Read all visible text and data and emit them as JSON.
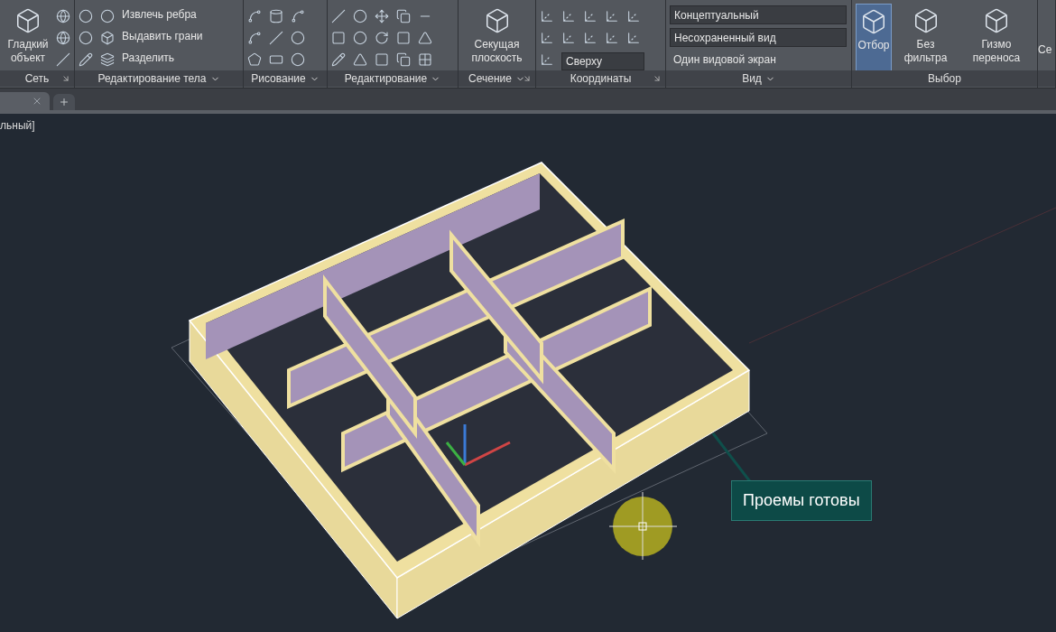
{
  "ribbon": {
    "panels": [
      {
        "title": "Сеть",
        "menu": false,
        "launcher": true,
        "tools": [
          {
            "kind": "large",
            "label": "Гладкий объект",
            "selected": false
          }
        ]
      },
      {
        "title": "Редактирование тела",
        "menu": true,
        "launcher": false,
        "tools": [
          {
            "kind": "row",
            "label": "Извлечь ребра"
          },
          {
            "kind": "row",
            "label": "Выдавить грани"
          },
          {
            "kind": "row",
            "label": "Разделить"
          }
        ]
      },
      {
        "title": "Рисование",
        "menu": true,
        "launcher": false
      },
      {
        "title": "Редактирование",
        "menu": true,
        "launcher": false
      },
      {
        "title": "Сечение",
        "menu": true,
        "launcher": true,
        "tools": [
          {
            "kind": "large",
            "label": "Секущая плоскость",
            "selected": false
          }
        ]
      },
      {
        "title": "Координаты",
        "menu": false,
        "launcher": true,
        "tools": [
          {
            "kind": "combo",
            "label": "Сверху"
          }
        ]
      },
      {
        "title": "Вид",
        "menu": true,
        "launcher": false,
        "tools": [
          {
            "kind": "combo",
            "label": "Концептуальный"
          },
          {
            "kind": "combo",
            "label": "Несохраненный вид"
          },
          {
            "kind": "row",
            "label": "Один видовой экран"
          }
        ]
      },
      {
        "title": "Выбор",
        "menu": false,
        "launcher": false,
        "tools": [
          {
            "kind": "large",
            "label": "Отбор",
            "selected": true
          },
          {
            "kind": "large",
            "label": "Без фильтра",
            "selected": false
          },
          {
            "kind": "large",
            "label": "Гизмо переноса",
            "selected": false
          }
        ]
      },
      {
        "tools": [
          {
            "kind": "large",
            "label": "Се",
            "selected": false
          }
        ]
      }
    ]
  },
  "viewport": {
    "label": "льный]",
    "callout": "Проемы готовы"
  }
}
